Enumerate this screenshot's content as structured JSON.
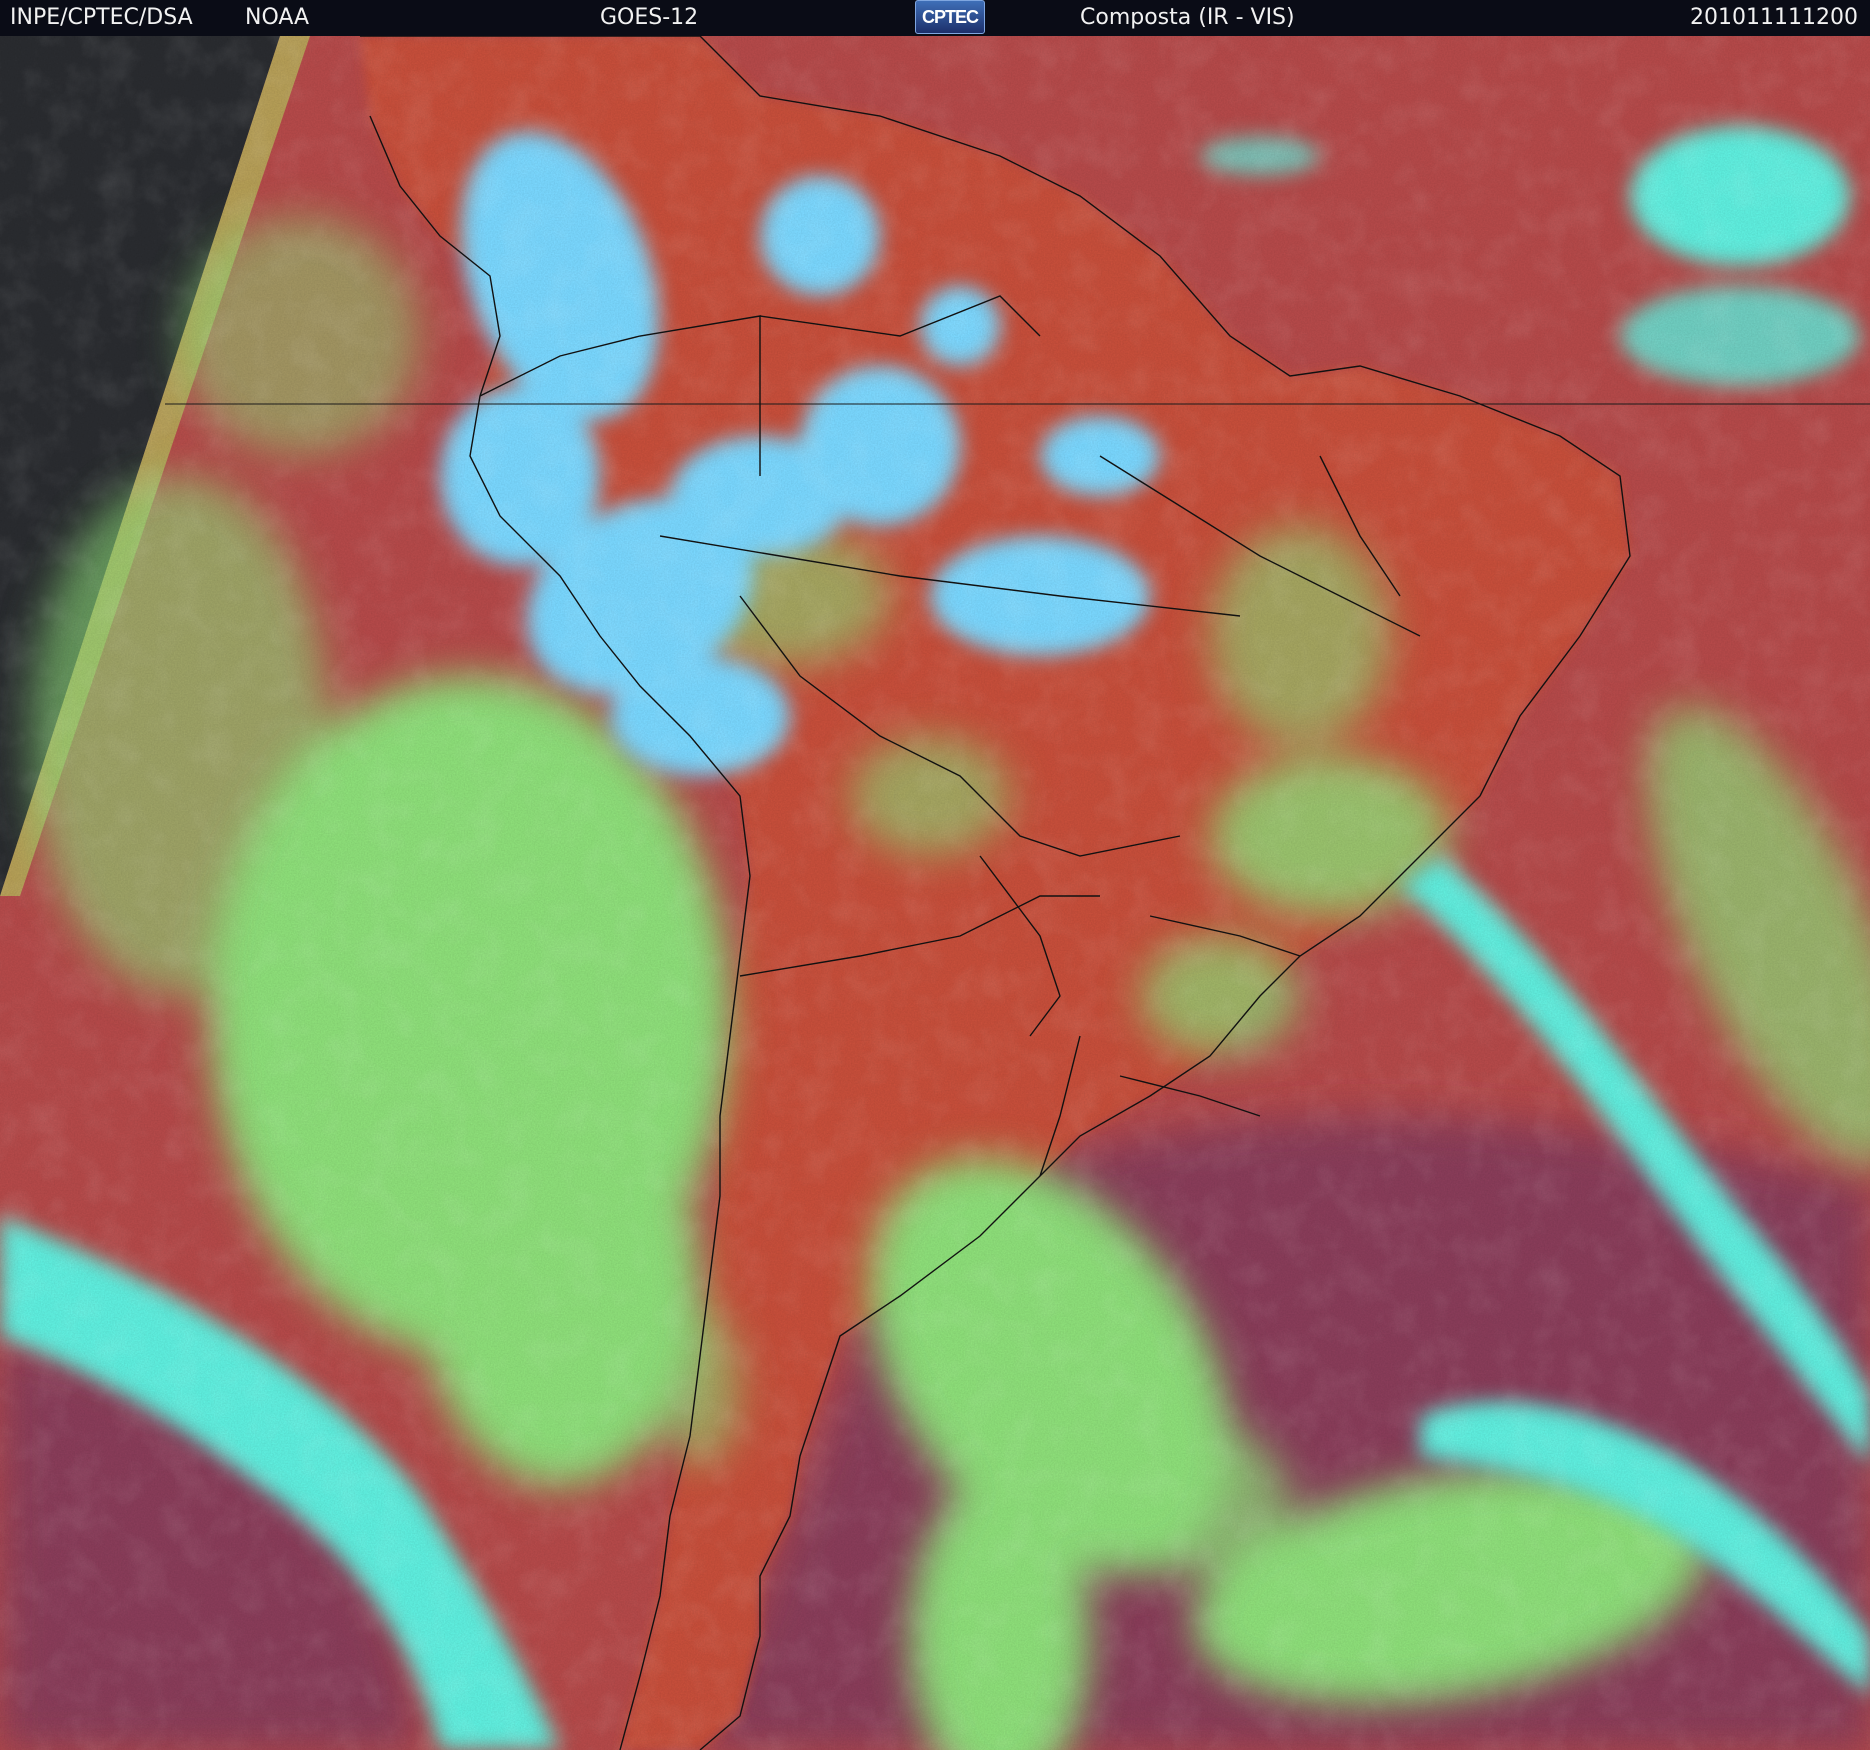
{
  "header": {
    "agency": "INPE/CPTEC/DSA",
    "partner": "NOAA",
    "satellite": "GOES-12",
    "logo_text": "CPTEC",
    "product": "Composta (IR - VIS)",
    "timestamp": "201011111200"
  },
  "colors": {
    "clear_land": "#c8503a",
    "clear_ocean": "#b64a4a",
    "southern_ocean": "#8a3d5a",
    "low_cloud": "#8ee07a",
    "high_cloud": "#5ef0e0",
    "deep_convection": "#7ad8ff",
    "no_data": "#2a2c30",
    "borders": "#111111"
  }
}
